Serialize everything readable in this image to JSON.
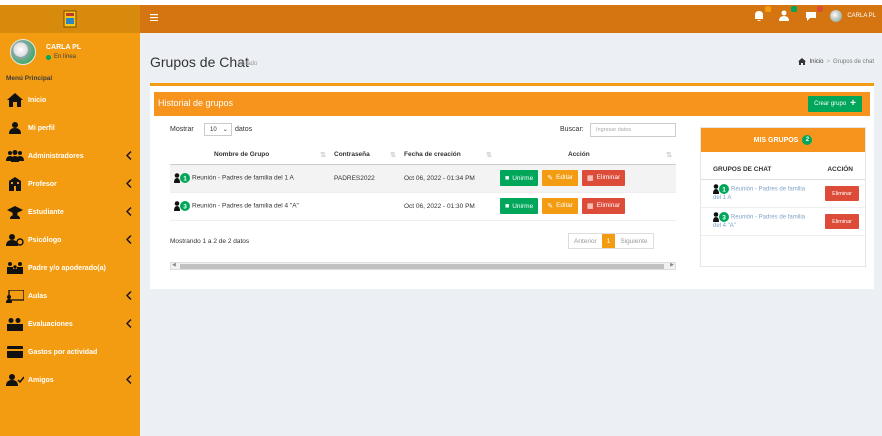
{
  "sidebar": {
    "user_name": "CARLA PL",
    "user_status": "En línea",
    "menu_header": "Menú Principal",
    "items": [
      {
        "label": "Inicio",
        "icon": "home-icon",
        "chevron": false
      },
      {
        "label": "Mi perfil",
        "icon": "user-icon",
        "chevron": false
      },
      {
        "label": "Administradores",
        "icon": "users-icon",
        "chevron": true
      },
      {
        "label": "Profesor",
        "icon": "building-icon",
        "chevron": true
      },
      {
        "label": "Estudiante",
        "icon": "graduation-icon",
        "chevron": true
      },
      {
        "label": "Psicólogo",
        "icon": "user-doctor-icon",
        "chevron": true
      },
      {
        "label": "Padre y/o apoderado(a)",
        "icon": "family-icon",
        "chevron": false
      },
      {
        "label": "Aulas",
        "icon": "classroom-icon",
        "chevron": true
      },
      {
        "label": "Evaluaciones",
        "icon": "evaluations-icon",
        "chevron": true
      },
      {
        "label": "Gastos por actividad",
        "icon": "credit-card-icon",
        "chevron": false
      },
      {
        "label": "Amigos",
        "icon": "friends-icon",
        "chevron": true
      }
    ]
  },
  "header": {
    "profile_name": "CARLA PL",
    "badge_colors": [
      "#f39c12",
      "#00a65a",
      "#dd4b39"
    ]
  },
  "page": {
    "title": "Grupos de Chat",
    "subtitle": "Listado",
    "breadcrumb_home": "Inicio",
    "breadcrumb_current": "Grupos de chat"
  },
  "panel": {
    "title": "Historial de grupos",
    "create_button": "Crear grupo",
    "show_label": "Mostrar",
    "show_value": "10",
    "show_suffix": "datos",
    "search_label": "Buscar:",
    "search_placeholder": "Ingresar datos",
    "columns": [
      "Nombre de Grupo",
      "Contraseña",
      "Fecha de creación",
      "Acción"
    ],
    "rows": [
      {
        "group_count": "1",
        "name": "Reunión - Padres de familia del 1 A",
        "password": "PADRES2022",
        "created": "Oct 06, 2022 - 01:34 PM"
      },
      {
        "group_count": "3",
        "name": "Reunión - Padres de familia del 4 \"A\"",
        "password": "",
        "created": "Oct 06, 2022 - 01:30 PM"
      }
    ],
    "join_label": "Unirme",
    "edit_label": "Editar",
    "delete_label": "Eliminar",
    "showing": "Mostrando 1 a 2 de 2 datos",
    "prev_label": "Anterior",
    "page_number": "1",
    "next_label": "Siguiente"
  },
  "side": {
    "title": "MIS GRUPOS",
    "count": "2",
    "col_group": "GRUPOS DE CHAT",
    "col_action": "ACCIÓN",
    "rows": [
      {
        "group_count": "1",
        "name": "Reunión - Padres de familia del 1 A",
        "action": "Eliminar"
      },
      {
        "group_count": "3",
        "name": "Reunión - Padres de familia del 4 \"A\"",
        "action": "Eliminar"
      }
    ]
  },
  "colors": {
    "accent": "#f39c12",
    "header": "#d57512",
    "success": "#00a65a",
    "danger": "#dd4b39",
    "link": "#7fa3c8"
  }
}
